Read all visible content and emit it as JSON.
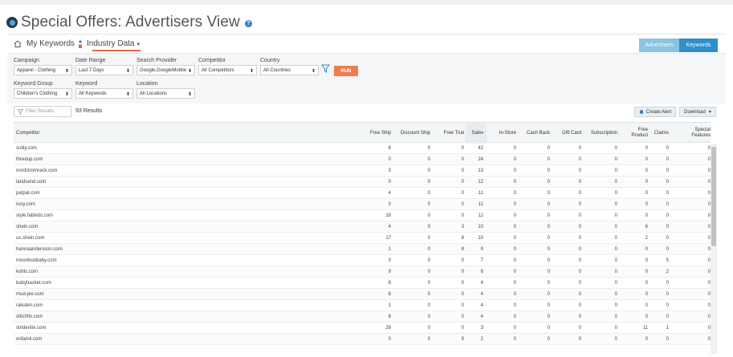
{
  "page": {
    "title": "Special Offers: Advertisers View",
    "help": "?"
  },
  "nav": {
    "my_keywords": "My Keywords",
    "industry_data": "Industry Data"
  },
  "toggle": {
    "advertisers": "Advertisers",
    "keywords": "Keywords",
    "active": "Keywords"
  },
  "colors": {
    "accent": "#2e8fca",
    "toggle_inactive": "#8bc3e0",
    "run": "#ee7e4f",
    "underline": "#e06a4a"
  },
  "filters": {
    "campaign": {
      "label": "Campaign",
      "value": "Apparel - Clothing"
    },
    "date_range": {
      "label": "Date Range",
      "value": "Last 7 Days"
    },
    "search_provider": {
      "label": "Search Provider",
      "value": "Google,GoogleMobile"
    },
    "competitor": {
      "label": "Competitor",
      "value": "All Competitors"
    },
    "country": {
      "label": "Country",
      "value": "All Countries"
    },
    "keyword_group": {
      "label": "Keyword Group",
      "value": "Children's Clothing"
    },
    "keyword": {
      "label": "Keyword",
      "value": "All Keywords"
    },
    "location": {
      "label": "Location",
      "value": "All Locations"
    },
    "run_label": "RUN"
  },
  "toolbar": {
    "filter_placeholder": "Filter Results",
    "results": "93 Results",
    "create_alert": "Create Alert",
    "download": "Download"
  },
  "table": {
    "columns": [
      "Competitor",
      "Free Ship",
      "Discount Ship",
      "Free Trial",
      "Sale",
      "In-Store",
      "Cash Back",
      "Gift Card",
      "Subscription",
      "Free Product",
      "Claims",
      "Special Features"
    ],
    "sort_column": "Sale",
    "rows": [
      [
        "zulily.com",
        "8",
        "0",
        "0",
        "42",
        "0",
        "0",
        "0",
        "0",
        "0",
        "0",
        "0"
      ],
      [
        "thredup.com",
        "0",
        "0",
        "0",
        "24",
        "0",
        "0",
        "0",
        "0",
        "0",
        "0",
        "0"
      ],
      [
        "nordstromrack.com",
        "3",
        "0",
        "0",
        "13",
        "0",
        "0",
        "0",
        "0",
        "0",
        "0",
        "0"
      ],
      [
        "landsend.com",
        "0",
        "0",
        "0",
        "12",
        "0",
        "0",
        "0",
        "0",
        "0",
        "0",
        "0"
      ],
      [
        "patpat.com",
        "4",
        "0",
        "0",
        "11",
        "0",
        "0",
        "0",
        "0",
        "0",
        "0",
        "0"
      ],
      [
        "rosy.com",
        "0",
        "0",
        "0",
        "11",
        "0",
        "0",
        "0",
        "0",
        "0",
        "0",
        "0"
      ],
      [
        "style.fabkids.com",
        "18",
        "0",
        "0",
        "11",
        "0",
        "0",
        "0",
        "0",
        "0",
        "0",
        "0"
      ],
      [
        "shein.com",
        "4",
        "0",
        "3",
        "10",
        "0",
        "0",
        "0",
        "0",
        "6",
        "0",
        "0"
      ],
      [
        "us.shein.com",
        "17",
        "0",
        "8",
        "10",
        "0",
        "0",
        "0",
        "0",
        "2",
        "0",
        "0"
      ],
      [
        "hannaandersson.com",
        "1",
        "0",
        "8",
        "9",
        "0",
        "0",
        "0",
        "0",
        "0",
        "0",
        "0"
      ],
      [
        "moonbunbaby.com",
        "0",
        "0",
        "0",
        "7",
        "0",
        "0",
        "0",
        "0",
        "0",
        "5",
        "0"
      ],
      [
        "kohls.com",
        "9",
        "0",
        "0",
        "6",
        "0",
        "0",
        "0",
        "0",
        "0",
        "2",
        "0"
      ],
      [
        "babybasket.com",
        "8",
        "0",
        "0",
        "4",
        "0",
        "0",
        "0",
        "0",
        "0",
        "0",
        "0"
      ],
      [
        "mud-pie.com",
        "8",
        "0",
        "0",
        "4",
        "0",
        "0",
        "0",
        "0",
        "0",
        "0",
        "0"
      ],
      [
        "rakuten.com",
        "1",
        "0",
        "0",
        "4",
        "0",
        "0",
        "0",
        "0",
        "0",
        "0",
        "0"
      ],
      [
        "stitchfix.com",
        "8",
        "0",
        "0",
        "4",
        "0",
        "0",
        "0",
        "0",
        "0",
        "0",
        "0"
      ],
      [
        "strideriite.com",
        "28",
        "0",
        "0",
        "3",
        "0",
        "0",
        "0",
        "0",
        "11",
        "1",
        "0"
      ],
      [
        "enfamil.com",
        "0",
        "0",
        "9",
        "2",
        "0",
        "0",
        "0",
        "0",
        "0",
        "0",
        "0"
      ]
    ]
  }
}
